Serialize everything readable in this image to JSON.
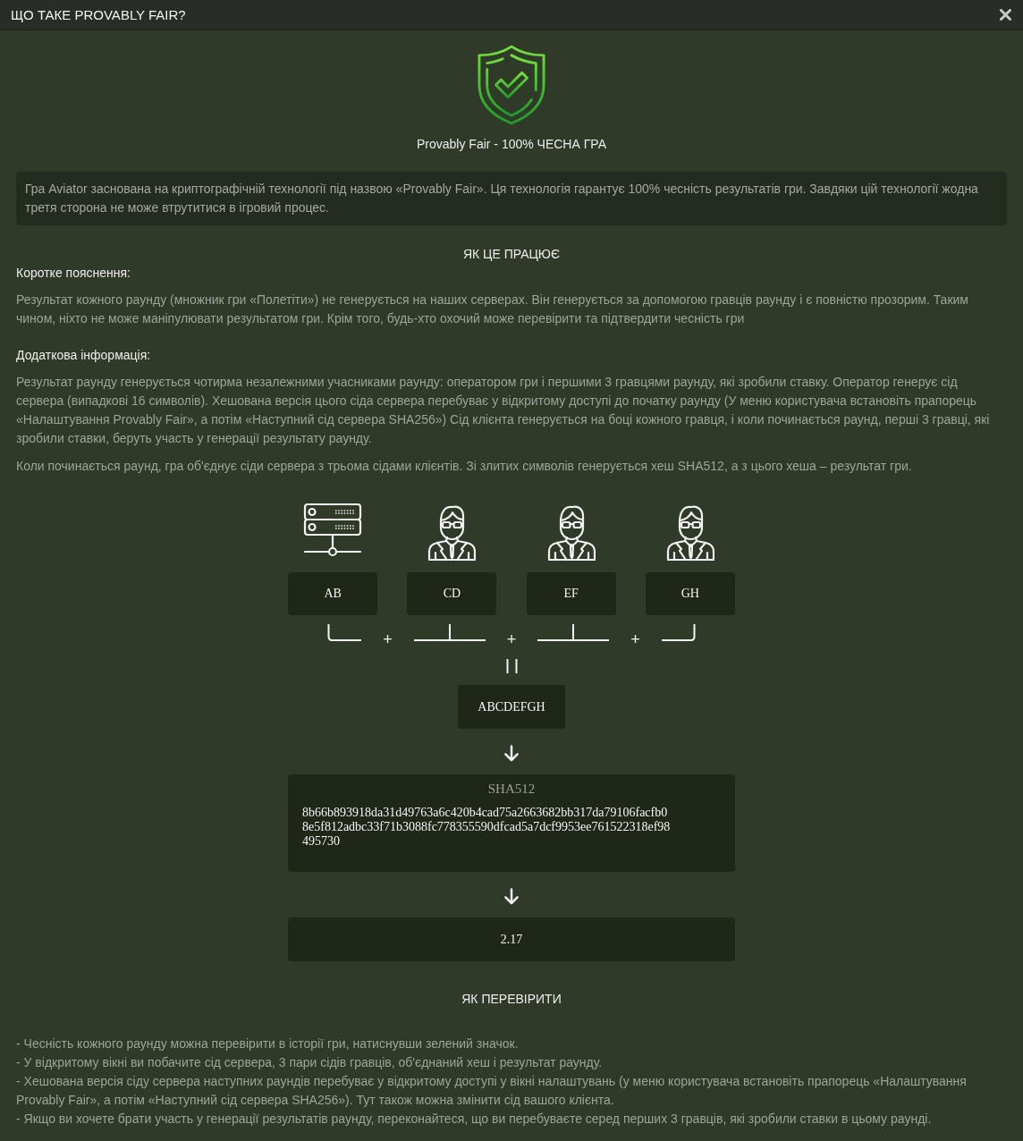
{
  "window": {
    "title": "ЩО ТАКЕ PROVABLY FAIR?"
  },
  "hero": {
    "caption": "Provably Fair - 100% ЧЕСНА ГРА"
  },
  "intro": "Гра Aviator заснована на криптографічній технології під назвою «Provably Fair». Ця технологія гарантує 100% чесність результатів гри. Завдяки цій технології жодна третя сторона не може втрутитися в ігровий процес.",
  "how_it_works": {
    "heading": "ЯК ЦЕ ПРАЦЮЄ",
    "sections": [
      {
        "title": "Коротке пояснення:",
        "paragraphs": [
          "Результат кожного раунду (множник гри «Полетіти») не генерується на наших серверах. Він генерується за допомогою гравців раунду і є повністю прозорим. Таким чином, ніхто не може маніпулювати результатом гри. Крім того, будь-хто охочий може перевірити та підтвердити чесність гри"
        ]
      },
      {
        "title": "Додаткова інформація:",
        "paragraphs": [
          "Результат раунду генерується чотирма незалежними учасниками раунду: оператором гри і першими 3 гравцями раунду, які зробили ставку. Оператор генерує сід сервера (випадкові 16 символів). Хешована версія цього сіда сервера перебуває у відкритому доступі до початку раунду (У меню користувача встановіть прапорець «Налаштування Provably Fair», а потім «Наступний сід сервера SHA256») Сід клієнта генерується на боці кожного гравця, і коли починається раунд, перші 3 гравці, які зробили ставки, беруть участь у генерації результату раунду.",
          "Коли починається раунд, гра об'єднує сіди сервера з трьома сідами клієнтів. Зі злитих символів генерується хеш SHA512, а з цього хеша – результат гри."
        ]
      }
    ]
  },
  "diagram": {
    "sources": [
      {
        "kind": "server",
        "seed": "AB"
      },
      {
        "kind": "player",
        "seed": "CD"
      },
      {
        "kind": "player",
        "seed": "EF"
      },
      {
        "kind": "player",
        "seed": "GH"
      }
    ],
    "joins": [
      "+",
      "+",
      "+"
    ],
    "combined": "ABCDEFGH",
    "hash": {
      "title": "SHA512",
      "value": "8b66b893918da31d49763a6c420b4cad75a2663682bb317da79106facfb08e5f812adbc33f71b3088fc778355590dfcad5a7dcf9953ee761522318ef98495730"
    },
    "result": "2.17"
  },
  "verify": {
    "heading": "ЯК ПЕРЕВІРИТИ",
    "items": [
      "- Чесність кожного раунду можна перевірити в історії гри, натиснувши зелений значок.",
      "- У відкритому вікні ви побачите сід сервера, 3 пари сідів гравців, об'єднаний хеш і результат раунду.",
      "- Хешована версія сіду сервера наступних раундів перебуває у відкритому доступі у вікні налаштувань (у меню користувача встановіть прапорець «Налаштування Provably Fair», а потім «Наступний сід сервера SHA256»). Тут також можна змінити сід вашого клієнта.",
      "- Якщо ви хочете брати участь у генерації результатів раунду, переконайтеся, що ви перебуваєте серед перших 3 гравців, які зробили ставки в цьому раунді."
    ]
  }
}
